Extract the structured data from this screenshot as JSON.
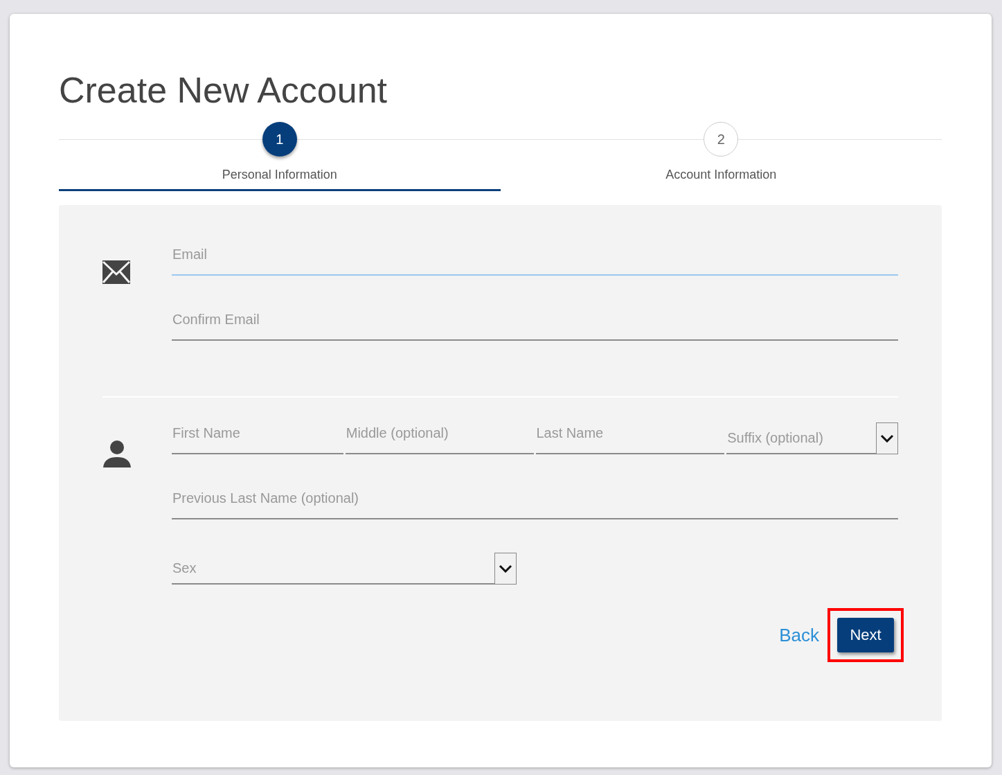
{
  "title": "Create New Account",
  "steps": [
    {
      "number": "1",
      "label": "Personal Information",
      "selected": true
    },
    {
      "number": "2",
      "label": "Account Information",
      "selected": false
    }
  ],
  "sections": [
    {
      "rows": [
        [
          {
            "kind": "text",
            "placeholder": "Email",
            "focused": true
          }
        ],
        [
          {
            "kind": "text",
            "placeholder": "Confirm Email",
            "focused": false
          }
        ]
      ]
    },
    {
      "rows": [
        [
          {
            "kind": "text",
            "placeholder": "First Name",
            "focused": false
          },
          {
            "kind": "text",
            "placeholder": "Middle (optional)",
            "focused": false
          },
          {
            "kind": "text",
            "placeholder": "Last Name",
            "focused": false
          },
          {
            "kind": "select",
            "placeholder": "Suffix (optional)",
            "focused": false
          }
        ],
        [
          {
            "kind": "text",
            "placeholder": "Previous Last Name (optional)",
            "focused": false
          }
        ],
        [
          {
            "kind": "select",
            "placeholder": "Sex",
            "focused": false,
            "half": true
          }
        ]
      ]
    }
  ],
  "back": {
    "label": "Back"
  },
  "next": {
    "label": "Next",
    "highlighted": true
  }
}
